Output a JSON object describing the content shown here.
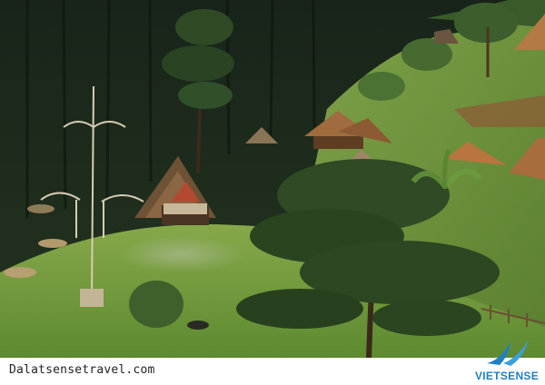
{
  "photo": {
    "subject": "hillside-village-with-huts-and-pine-forest"
  },
  "watermark": {
    "site_url": "Dalatsensetravel.com",
    "brand": "VIETSENSE",
    "brand_color": "#1f7fc4"
  },
  "palette": {
    "forest_dark": "#1d2a1a",
    "lawn": "#6f9a3c",
    "hut_roof": "#9a6a3c",
    "sky_haze": "#c9d3b8"
  }
}
